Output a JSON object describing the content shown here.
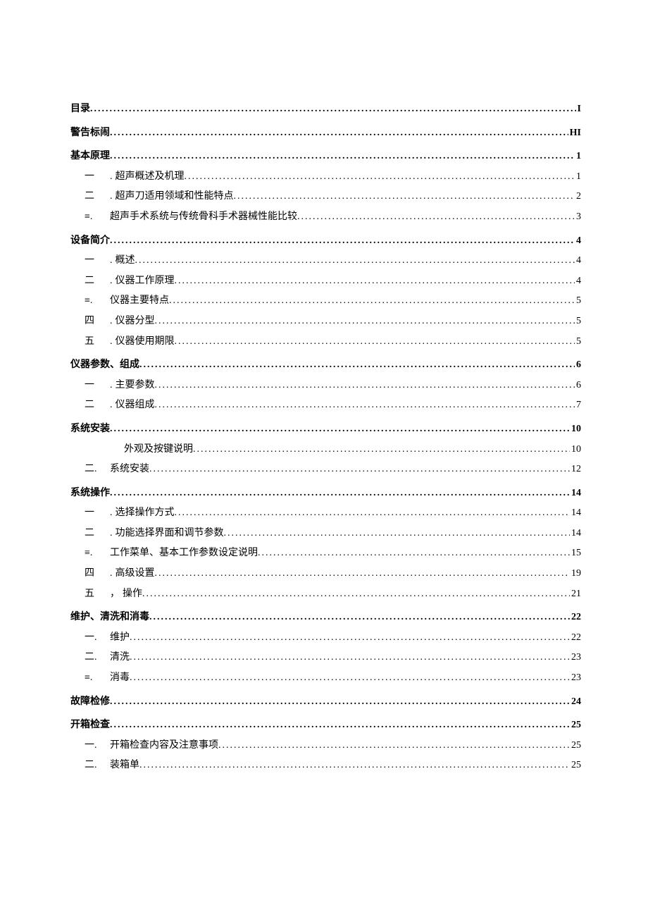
{
  "toc": [
    {
      "level": 1,
      "num": "",
      "sep": "",
      "label": "目录",
      "page": "I"
    },
    {
      "level": 1,
      "num": "",
      "sep": "",
      "label": "警告标闹",
      "page": "HI"
    },
    {
      "level": 1,
      "num": "",
      "sep": "",
      "label": "基本原理",
      "page": "1"
    },
    {
      "level": 2,
      "num": "一",
      "sep": ".",
      "label": "超声概述及机理",
      "page": "1"
    },
    {
      "level": 2,
      "num": "二",
      "sep": ".",
      "label": "超声刀适用领域和性能特点",
      "page": "2"
    },
    {
      "level": 2,
      "num": "≡.",
      "sep": "",
      "label": "超声手术系统与传统骨科手术器械性能比较",
      "page": "3"
    },
    {
      "level": 1,
      "num": "",
      "sep": "",
      "label": "设备简介",
      "page": "4"
    },
    {
      "level": 2,
      "num": "一",
      "sep": ".",
      "label": "概述",
      "page": "4"
    },
    {
      "level": 2,
      "num": "二",
      "sep": ".",
      "label": "仪器工作原理",
      "page": "4"
    },
    {
      "level": 2,
      "num": "≡.",
      "sep": "",
      "label": "仪器主要特点",
      "page": "5"
    },
    {
      "level": 2,
      "num": "四",
      "sep": ".",
      "label": "仪器分型",
      "page": "5"
    },
    {
      "level": 2,
      "num": "五",
      "sep": ".",
      "label": "仪器使用期限",
      "page": "5"
    },
    {
      "level": 1,
      "num": "",
      "sep": "",
      "label": "仪器参数、组成",
      "page": "6"
    },
    {
      "level": 2,
      "num": "一",
      "sep": ".",
      "label": "主要参数",
      "page": "6"
    },
    {
      "level": 2,
      "num": "二",
      "sep": ".",
      "label": "仪器组成",
      "page": "7"
    },
    {
      "level": 1,
      "num": "",
      "sep": "",
      "label": "系统安装",
      "page": "10"
    },
    {
      "level": 2,
      "num": "",
      "sep": "",
      "label": "外观及按键说明",
      "page": "10",
      "indent": 76
    },
    {
      "level": 2,
      "num": "二.",
      "sep": "",
      "label": "系统安装",
      "page": "12"
    },
    {
      "level": 1,
      "num": "",
      "sep": "",
      "label": "系统操作",
      "page": "14"
    },
    {
      "level": 2,
      "num": "一",
      "sep": ".",
      "label": "选择操作方式",
      "page": "14"
    },
    {
      "level": 2,
      "num": "二",
      "sep": ".",
      "label": "功能选择界面和调节参数",
      "page": "14"
    },
    {
      "level": 2,
      "num": "≡.",
      "sep": "",
      "label": "工作菜单、基本工作参数设定说明",
      "page": "15"
    },
    {
      "level": 2,
      "num": "四",
      "sep": ".",
      "label": "高级设置",
      "page": "19"
    },
    {
      "level": 2,
      "num": "五",
      "sep": "，",
      "label": "操作",
      "page": "21"
    },
    {
      "level": 1,
      "num": "",
      "sep": "",
      "label": "维护、清洗和消毒",
      "page": "22"
    },
    {
      "level": 2,
      "num": "一.",
      "sep": "",
      "label": "维护",
      "page": "22"
    },
    {
      "level": 2,
      "num": "二.",
      "sep": "",
      "label": "清洗",
      "page": "23"
    },
    {
      "level": 2,
      "num": "≡.",
      "sep": "",
      "label": "消毒",
      "page": "23"
    },
    {
      "level": 1,
      "num": "",
      "sep": "",
      "label": "故障检修",
      "page": "24"
    },
    {
      "level": 1,
      "num": "",
      "sep": "",
      "label": "开箱检查",
      "page": "25"
    },
    {
      "level": 2,
      "num": "一.",
      "sep": "",
      "label": "开箱检查内容及注意事项",
      "page": "25"
    },
    {
      "level": 2,
      "num": "二.",
      "sep": "",
      "label": "装箱单",
      "page": "25"
    }
  ]
}
